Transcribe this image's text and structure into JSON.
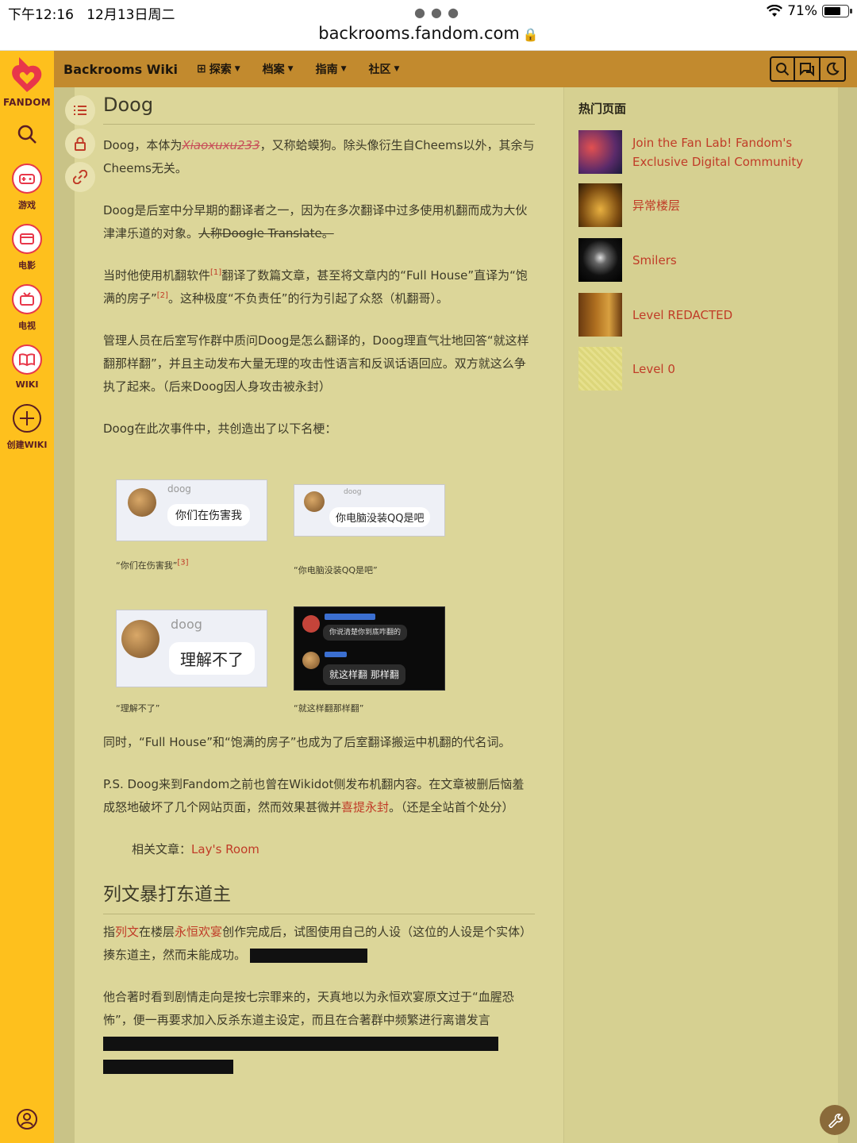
{
  "status": {
    "time": "下午12:16",
    "date": "12月13日周二",
    "url": "backrooms.fandom.com",
    "battery": "71%",
    "battery_level": 0.71
  },
  "rail": {
    "brand": "FANDOM",
    "games": "游戏",
    "movies": "电影",
    "tv": "电视",
    "wiki": "WIKI",
    "create": "创建WIKI"
  },
  "nav": {
    "wiki_name": "Backrooms Wiki",
    "explore": "探索",
    "archive": "档案",
    "guide": "指南",
    "community": "社区"
  },
  "article": {
    "title": "Doog",
    "p1_a": "Doog，本体为",
    "p1_strike": "Xiaoxuxu233",
    "p1_b": "，又称蛤蟆狗。除头像衍生自Cheems以外，其余与Cheems无关。",
    "p2_a": "Doog是后室中分早期的翻译者之一，因为在多次翻译中过多使用机翻而成为大伙津津乐道的对象。",
    "p2_strike": "人称Doogle Translate。",
    "p3_a": "当时他使用机翻软件",
    "p3_ref1": "[1]",
    "p3_b": "翻译了数篇文章，甚至将文章内的“Full House”直译为“饱满的房子”",
    "p3_ref2": "[2]",
    "p3_c": "。这种极度“不负责任”的行为引起了众怒（机翻哥）。",
    "p4": "管理人员在后室写作群中质问Doog是怎么翻译的，Doog理直气壮地回答“就这样翻那样翻”，并且主动发布大量无理的攻击性语言和反讽话语回应。双方就这么争执了起来。（后来Doog因人身攻击被永封）",
    "p5": "Doog在此次事件中，共创造出了以下名梗：",
    "g1_name": "doog",
    "g1_msg": "你们在伤害我",
    "g1_cap": "“你们在伤害我”",
    "g1_ref": "[3]",
    "g2_name": "doog",
    "g2_msg": "你电脑没装QQ是吧",
    "g2_cap": "“你电脑没装QQ是吧”",
    "g3_name": "doog",
    "g3_msg": "理解不了",
    "g3_cap": "“理解不了”",
    "g4_msg1": "你说清楚你到底咋翻的",
    "g4_msg2": "就这样翻 那样翻",
    "g4_cap": "“就这样翻那样翻”",
    "p6": "同时，“Full House”和“饱满的房子”也成为了后室翻译搬运中机翻的代名词。",
    "p7_a": "P.S. Doog来到Fandom之前也曾在Wikidot侧发布机翻内容。在文章被删后恼羞成怒地破坏了几个网站页面，然而效果甚微并",
    "p7_link": "喜提永封",
    "p7_b": "。（还是全站首个处分）",
    "related_label": "相关文章：",
    "related_link": "Lay's Room",
    "h2": "列文暴打东道主",
    "p8_a": "指",
    "p8_link1": "列文",
    "p8_b": "在楼层",
    "p8_link2": "永恒欢宴",
    "p8_c": "创作完成后，试图使用自己的人设（这位的人设是个实体）揍东道主，然而未能成功。",
    "p9": "他合著时看到剧情走向是按七宗罪来的，天真地以为永恒欢宴原文过于“血腥恐怖”，便一再要求加入反杀东道主设定，而且在合著群中频繁进行离谱发言"
  },
  "sidebar": {
    "title": "热门页面",
    "items": [
      {
        "label": "Join the Fan Lab! Fandom's Exclusive Digital Community"
      },
      {
        "label": "异常楼层"
      },
      {
        "label": "Smilers"
      },
      {
        "label": "Level RED​ACTED"
      },
      {
        "label": "Level 0"
      }
    ]
  },
  "colors": {
    "rail": "#fec01d",
    "nav": "#c28a2e",
    "page_bg": "#dcd699",
    "link": "#c03c28"
  }
}
